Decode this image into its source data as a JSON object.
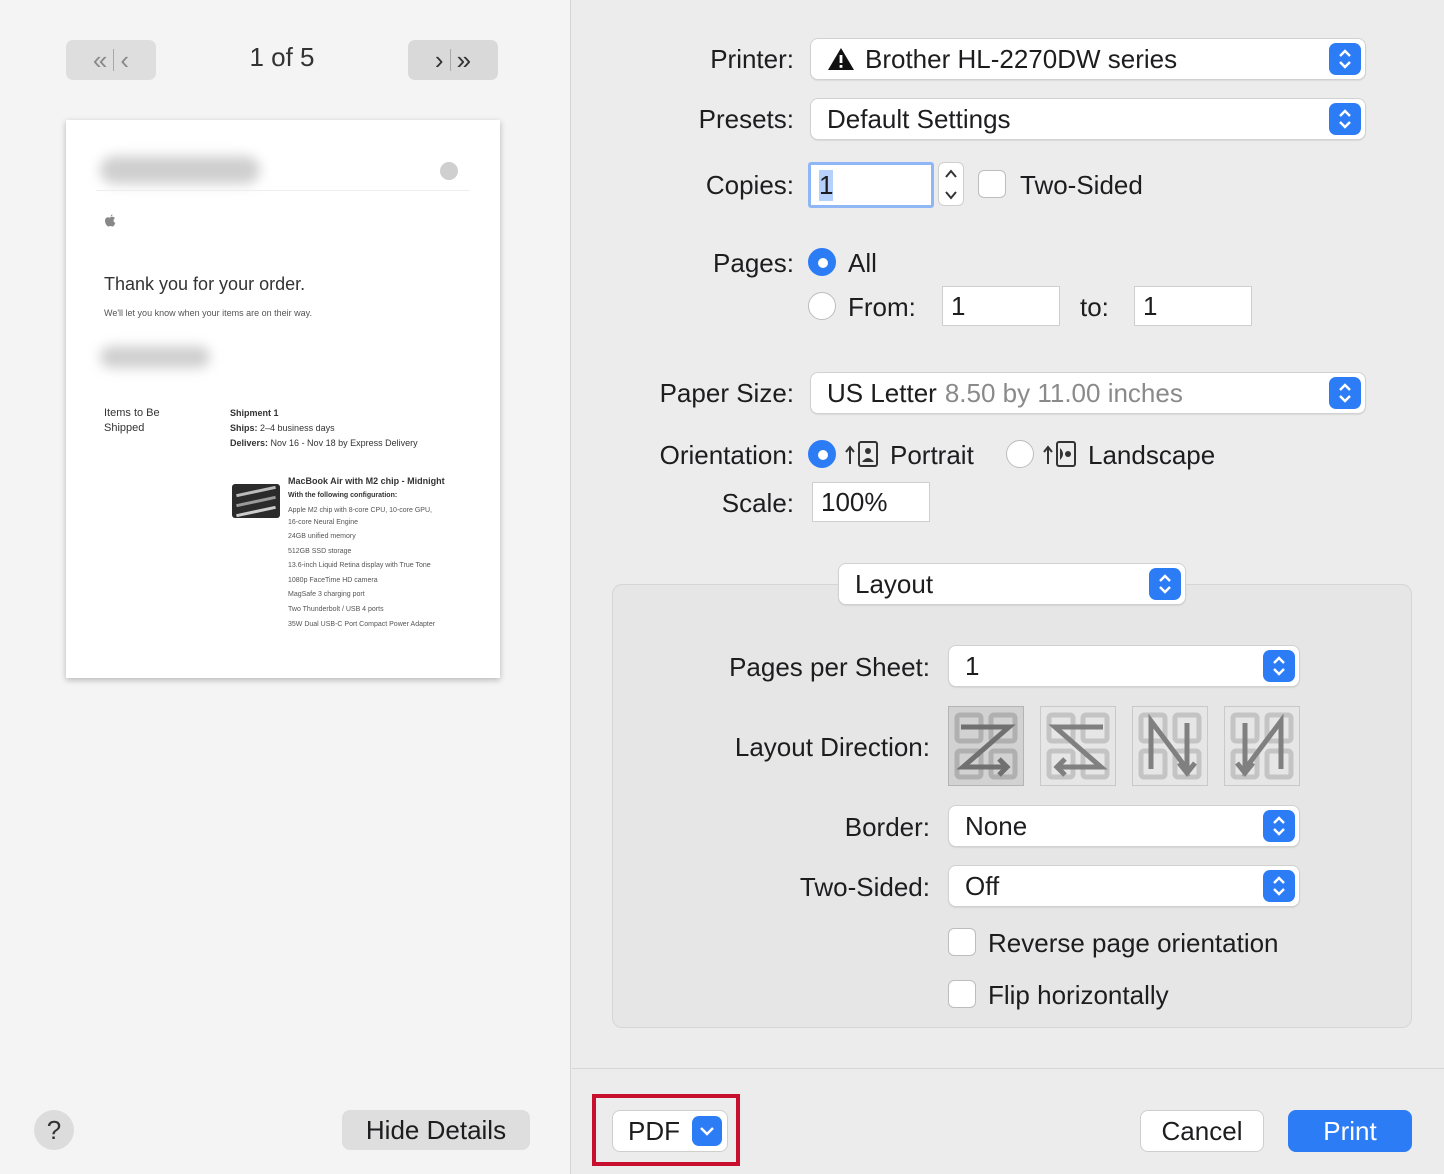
{
  "preview": {
    "page_indicator": "1 of 5",
    "doc": {
      "title": "Thank you for your order.",
      "subtitle": "We'll let you know when your items are on their way.",
      "items_label": "Items to Be Shipped",
      "shipment_label": "Shipment 1",
      "ships_label": "Ships:",
      "ships_value": "2–4 business days",
      "delivers_label": "Delivers:",
      "delivers_value": "Nov 16 - Nov 18 by Express Delivery",
      "product_title": "MacBook Air with M2 chip - Midnight",
      "config_label": "With the following configuration:",
      "config_lines": [
        "Apple M2 chip with 8-core CPU, 10-core GPU,",
        "16-core Neural Engine",
        "24GB unified memory",
        "512GB SSD storage",
        "13.6-inch Liquid Retina display with True Tone",
        "1080p FaceTime HD camera",
        "MagSafe 3 charging port",
        "Two Thunderbolt / USB 4 ports",
        "35W Dual USB-C Port Compact Power Adapter"
      ]
    },
    "help_label": "?",
    "hide_details_label": "Hide Details"
  },
  "settings": {
    "printer_label": "Printer:",
    "printer_value": "Brother HL-2270DW series",
    "presets_label": "Presets:",
    "presets_value": "Default Settings",
    "copies_label": "Copies:",
    "copies_value": "1",
    "two_sided_label": "Two-Sided",
    "pages_label": "Pages:",
    "pages_all_label": "All",
    "pages_from_label": "From:",
    "pages_from_value": "1",
    "pages_to_label": "to:",
    "pages_to_value": "1",
    "paper_size_label": "Paper Size:",
    "paper_size_value": "US Letter",
    "paper_size_detail": "8.50 by 11.00 inches",
    "orientation_label": "Orientation:",
    "portrait_label": "Portrait",
    "landscape_label": "Landscape",
    "scale_label": "Scale:",
    "scale_value": "100%",
    "section_value": "Layout",
    "pages_per_sheet_label": "Pages per Sheet:",
    "pages_per_sheet_value": "1",
    "layout_direction_label": "Layout Direction:",
    "border_label": "Border:",
    "border_value": "None",
    "layout_two_sided_label": "Two-Sided:",
    "layout_two_sided_value": "Off",
    "reverse_label": "Reverse page orientation",
    "flip_label": "Flip horizontally"
  },
  "footer": {
    "pdf_label": "PDF",
    "cancel_label": "Cancel",
    "print_label": "Print"
  },
  "colors": {
    "accent": "#2c7cf6",
    "highlight": "#c8102e"
  }
}
